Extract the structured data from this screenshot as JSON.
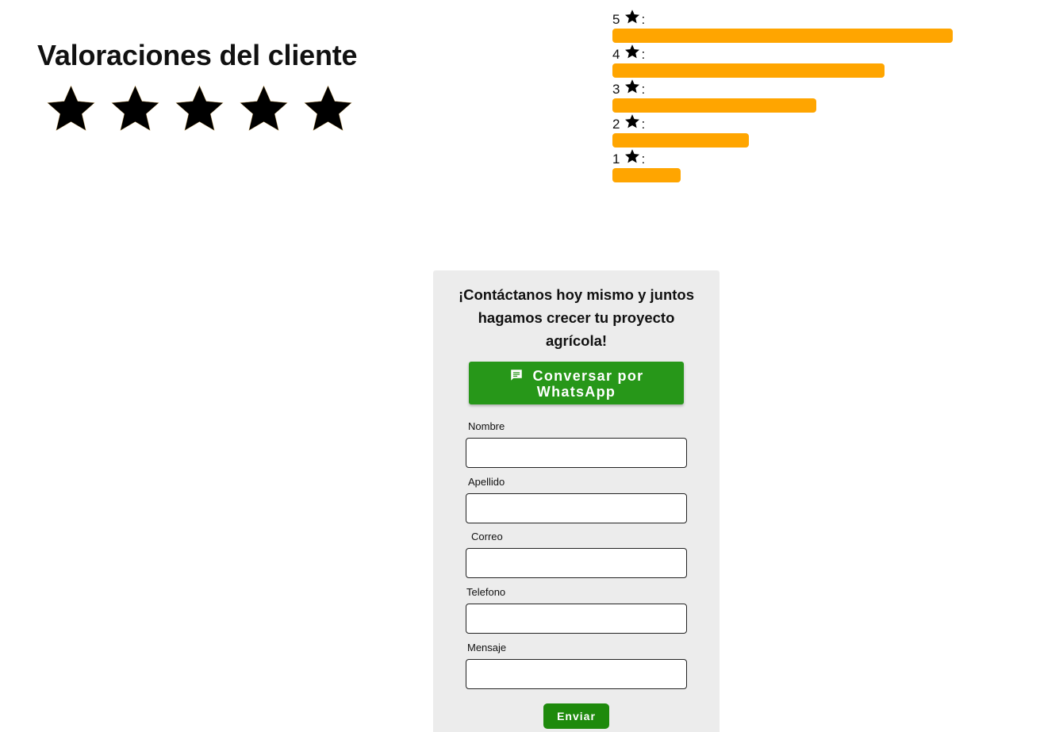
{
  "ratings": {
    "title": "Valoraciones del cliente",
    "average_stars_filled": 5,
    "star_icon": "star-icon",
    "star_color": "#000000"
  },
  "distribution": {
    "bar_color": "#ffa500",
    "rows": [
      {
        "stars": "5",
        "colon": ":",
        "fill_fraction": 1.0
      },
      {
        "stars": "4",
        "colon": ":",
        "fill_fraction": 0.8
      },
      {
        "stars": "3",
        "colon": ":",
        "fill_fraction": 0.6
      },
      {
        "stars": "2",
        "colon": ":",
        "fill_fraction": 0.4
      },
      {
        "stars": "1",
        "colon": ":",
        "fill_fraction": 0.2
      }
    ]
  },
  "contact": {
    "heading": "¡Contáctanos hoy mismo y juntos hagamos crecer tu proyecto agrícola!",
    "whatsapp_button_label": "Conversar por WhatsApp",
    "whatsapp_button_icon": "chat-icon",
    "whatsapp_color": "#279719",
    "fields": {
      "nombre": {
        "label": "Nombre",
        "value": "",
        "placeholder": ""
      },
      "apellido": {
        "label": "Apellido",
        "value": "",
        "placeholder": ""
      },
      "correo": {
        "label": "Correo",
        "value": "",
        "placeholder": ""
      },
      "telefono": {
        "label": "Telefono",
        "value": "",
        "placeholder": ""
      },
      "mensaje": {
        "label": "Mensaje",
        "value": "",
        "placeholder": ""
      }
    },
    "submit_label": "Enviar",
    "submit_color": "#1e8a0c"
  }
}
